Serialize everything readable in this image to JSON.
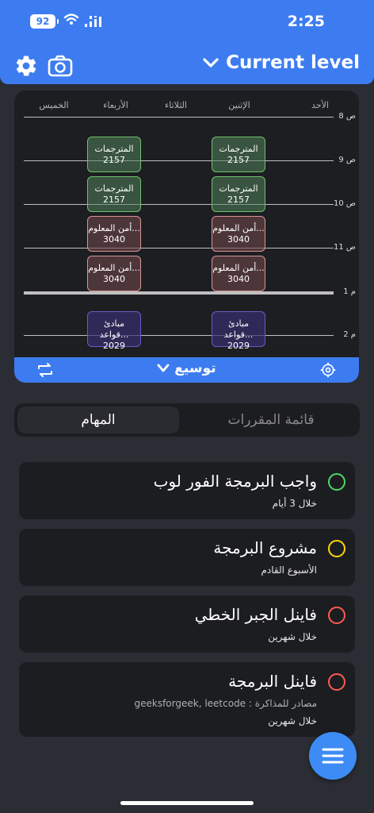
{
  "status_bar": {
    "time": "2:25",
    "battery": "92"
  },
  "header": {
    "title": "Current level"
  },
  "timetable": {
    "days": [
      "الأحد",
      "الإثنين",
      "الثلاثاء",
      "الأربعاء",
      "الخميس"
    ],
    "times": [
      "8 ص",
      "9 ص",
      "10 ص",
      "11 ص",
      "1 م",
      "2 م"
    ],
    "blocks": [
      {
        "name": "المترجمات",
        "number": "2157",
        "color": "green"
      },
      {
        "name": "المترجمات",
        "number": "2157",
        "color": "green"
      },
      {
        "name": "المترجمات",
        "number": "2157",
        "color": "green"
      },
      {
        "name": "المترجمات",
        "number": "2157",
        "color": "green"
      },
      {
        "name": "أمن المعلوم...",
        "number": "3040",
        "color": "red"
      },
      {
        "name": "أمن المعلوم...",
        "number": "3040",
        "color": "red"
      },
      {
        "name": "أمن المعلوم...",
        "number": "3040",
        "color": "red"
      },
      {
        "name": "أمن المعلوم...",
        "number": "3040",
        "color": "red"
      },
      {
        "name": "مبادئ قواعد...",
        "number": "2029",
        "color": "purple"
      },
      {
        "name": "مبادئ قواعد...",
        "number": "2029",
        "color": "purple"
      }
    ],
    "footer_label": "توسيع"
  },
  "segmented": {
    "active": "المهام",
    "inactive": "قائمة المقررات"
  },
  "tasks": [
    {
      "title": "واجب البرمجة الفور لوب",
      "due": "خلال 3 أيام",
      "status_color": "#4cd964"
    },
    {
      "title": "مشروع البرمجة",
      "due": "الأسبوع القادم",
      "status_color": "#ffd60a"
    },
    {
      "title": "فاينل الجبر الخطي",
      "due": "خلال شهرين",
      "status_color": "#ff5b4f"
    },
    {
      "title": "فاينل البرمجة",
      "note": "مصادر للمذاكرة : geeksforgeek, leetcode",
      "due": "خلال شهرين",
      "status_color": "#ff5b4f"
    }
  ]
}
